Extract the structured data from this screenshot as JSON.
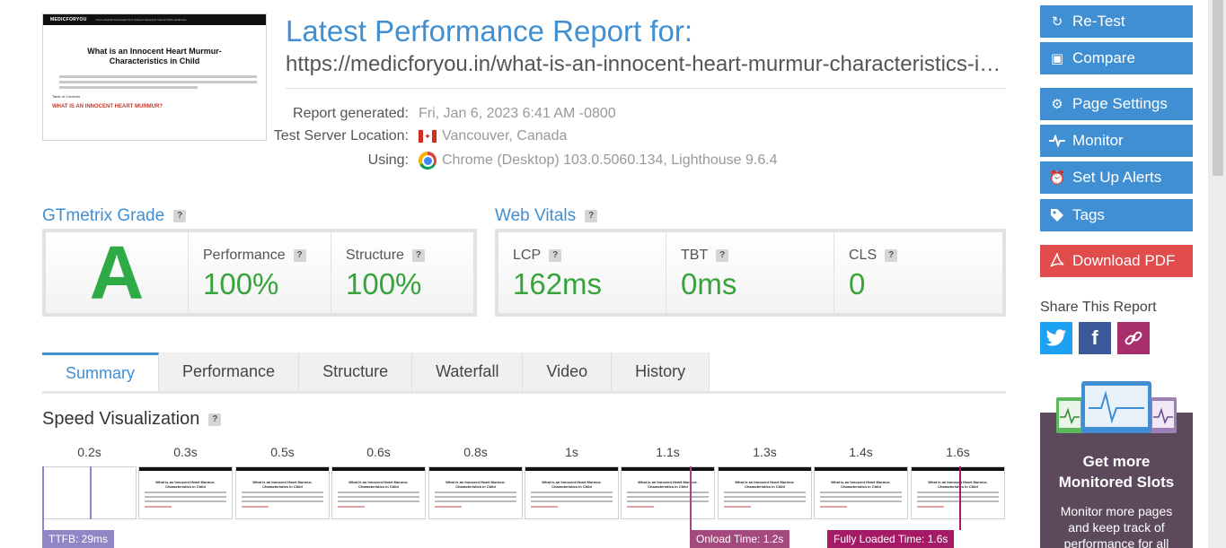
{
  "report": {
    "title": "Latest Performance Report for:",
    "url": "https://medicforyou.in/what-is-an-innocent-heart-murmur-characteristics-in-child/",
    "generated_label": "Report generated:",
    "generated_value": "Fri, Jan 6, 2023 6:41 AM -0800",
    "location_label": "Test Server Location:",
    "location_value": "Vancouver, Canada",
    "using_label": "Using:",
    "using_value": "Chrome (Desktop) 103.0.5060.134, Lighthouse 9.6.4"
  },
  "thumbnail": {
    "logo": "MEDICFORYOU",
    "nav": "Home   Medical Downloads   Plus   Subjects   Research   Clinical Skills   Healthcare",
    "title": "What is an Innocent Heart Murmur- Characteristics in Child",
    "toc": "Table of Contents",
    "heading": "WHAT IS AN INNOCENT HEART MURMUR?"
  },
  "grade": {
    "heading": "GTmetrix Grade",
    "letter": "A",
    "performance_label": "Performance",
    "performance_value": "100%",
    "structure_label": "Structure",
    "structure_value": "100%"
  },
  "vitals": {
    "heading": "Web Vitals",
    "lcp_label": "LCP",
    "lcp_value": "162ms",
    "tbt_label": "TBT",
    "tbt_value": "0ms",
    "cls_label": "CLS",
    "cls_value": "0"
  },
  "help": "?",
  "tabs": [
    {
      "label": "Summary"
    },
    {
      "label": "Performance"
    },
    {
      "label": "Structure"
    },
    {
      "label": "Waterfall"
    },
    {
      "label": "Video"
    },
    {
      "label": "History"
    }
  ],
  "speed": {
    "heading": "Speed Visualization",
    "frames": [
      "0.2s",
      "0.3s",
      "0.5s",
      "0.6s",
      "0.8s",
      "1s",
      "1.1s",
      "1.3s",
      "1.4s",
      "1.6s"
    ],
    "frame_title": "What is an Innocent Heart Murmur- Characteristics in Child",
    "ttfb": "TTFB: 29ms",
    "onload": "Onload Time: 1.2s",
    "fully_loaded": "Fully Loaded Time: 1.6s"
  },
  "sidebar": {
    "retest": "Re-Test",
    "compare": "Compare",
    "page_settings": "Page Settings",
    "monitor": "Monitor",
    "alerts": "Set Up Alerts",
    "tags": "Tags",
    "download_pdf": "Download PDF",
    "share_heading": "Share This Report",
    "promo_title_1": "Get more",
    "promo_title_2": "Monitored Slots",
    "promo_text_1": "Monitor more pages",
    "promo_text_2": "and keep track of",
    "promo_text_3": "performance for all"
  },
  "colors": {
    "accent": "#3f8fd2",
    "grade_green": "#2eaa46",
    "value_green": "#37a33b",
    "pdf_red": "#e04b4b",
    "ttfb": "#8f86c6",
    "onload": "#a4497d",
    "fully_loaded": "#a41a66"
  }
}
